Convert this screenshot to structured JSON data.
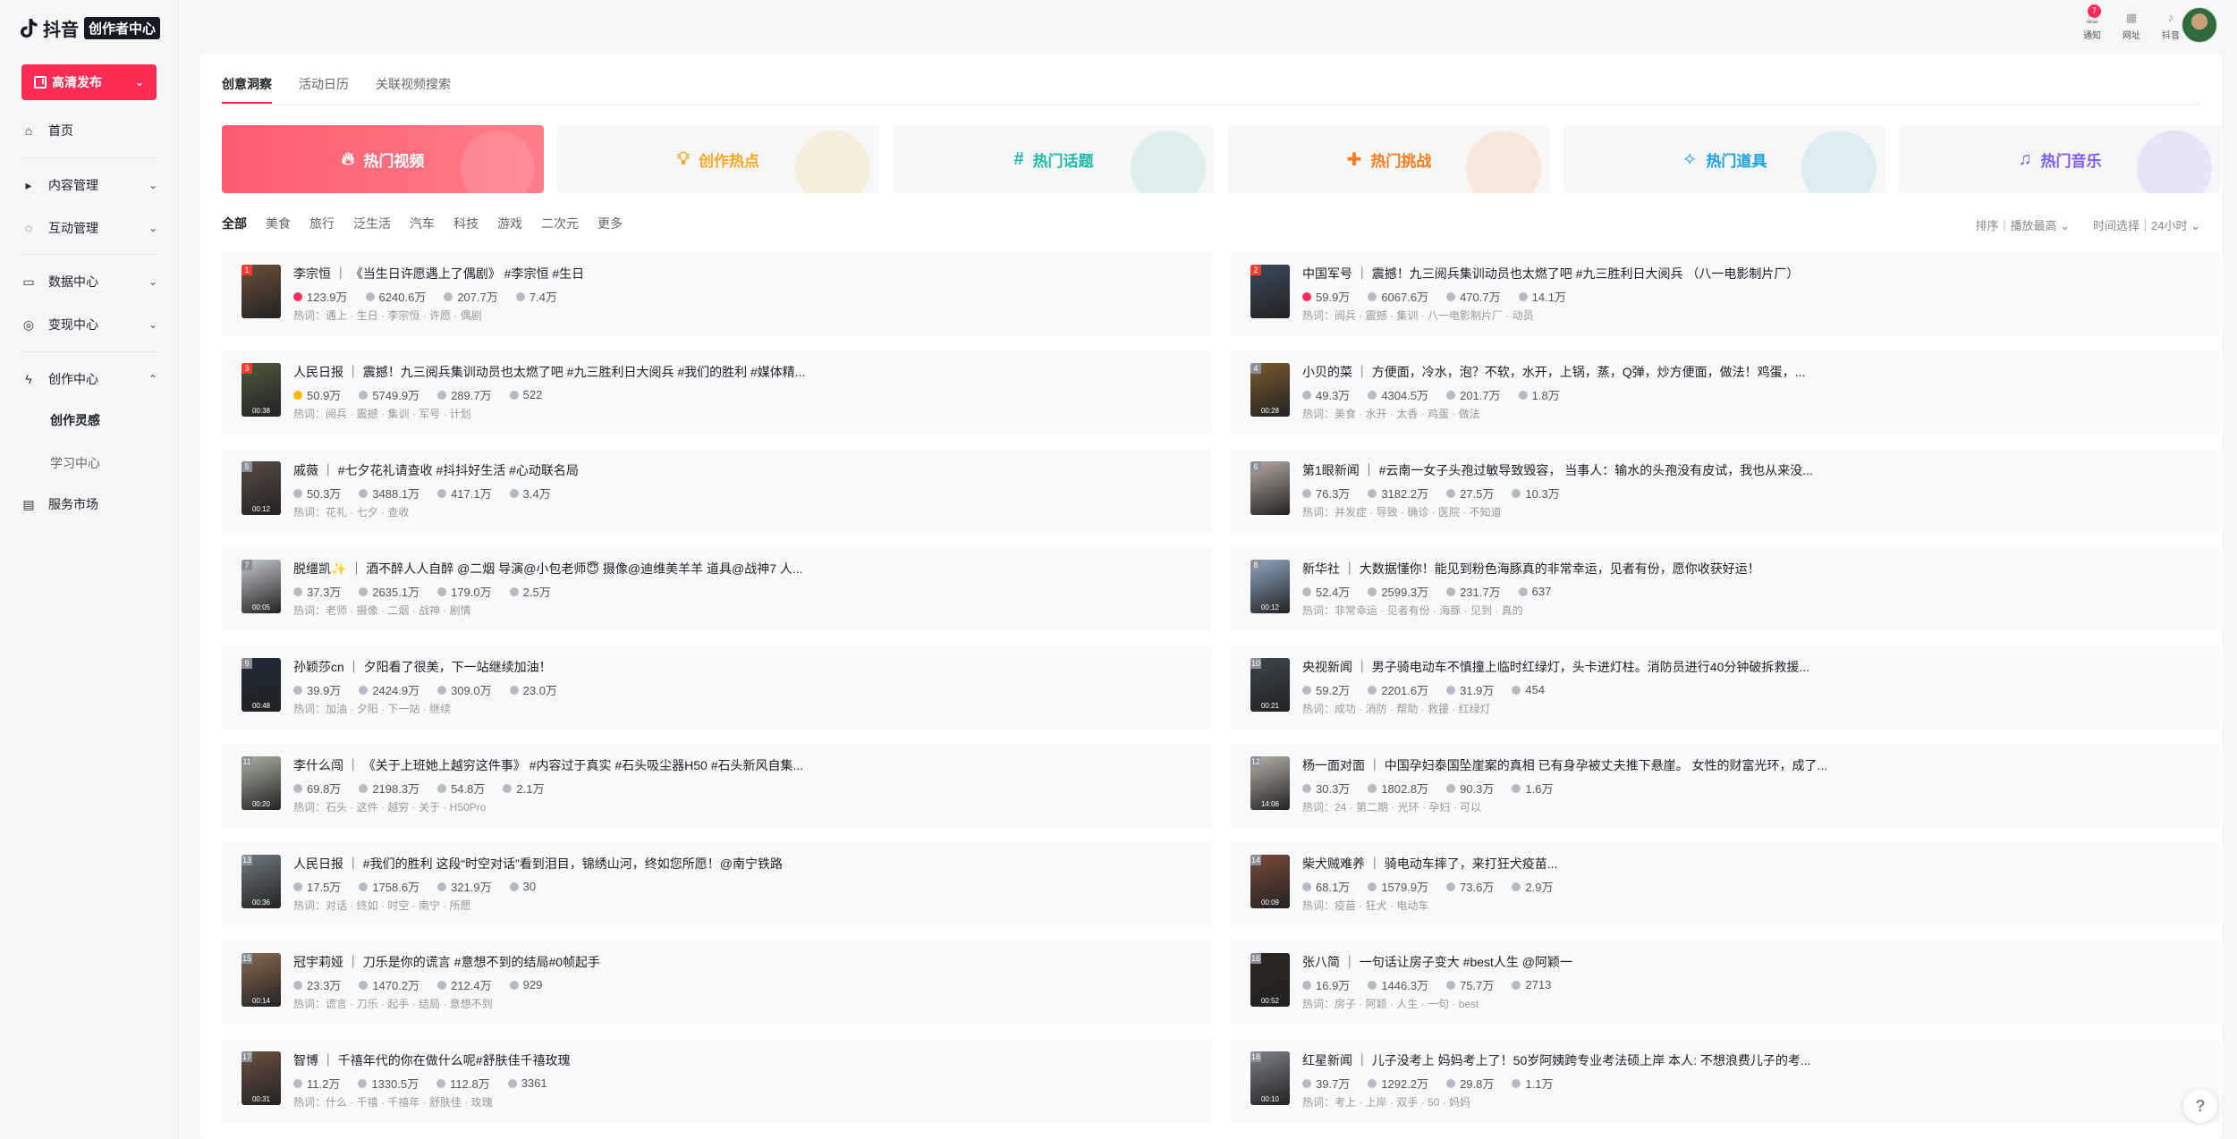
{
  "app": {
    "logo_text": "抖音",
    "badge": "创作者中心"
  },
  "sidebar": {
    "publish_label": "高清发布",
    "items": [
      {
        "label": "首页",
        "icon": "home-icon",
        "glyph": "⌂",
        "chevron": ""
      },
      {
        "label": "内容管理",
        "icon": "content-icon",
        "glyph": "▸",
        "chevron": "⌄"
      },
      {
        "label": "互动管理",
        "icon": "interaction-icon",
        "glyph": "◌",
        "chevron": "⌄"
      },
      {
        "label": "数据中心",
        "icon": "chart-icon",
        "glyph": "▭",
        "chevron": "⌄"
      },
      {
        "label": "变现中心",
        "icon": "monetize-icon",
        "glyph": "◎",
        "chevron": "⌄"
      },
      {
        "label": "创作中心",
        "icon": "bolt-icon",
        "glyph": "ϟ",
        "chevron": "⌃"
      },
      {
        "label": "服务市场",
        "icon": "market-icon",
        "glyph": "▤",
        "chevron": ""
      }
    ],
    "sub_items": [
      "创作灵感",
      "学习中心"
    ]
  },
  "header": {
    "icons": [
      {
        "label": "通知",
        "icon": "bell-icon",
        "glyph": "🔔︎",
        "badge": "7"
      },
      {
        "label": "网址",
        "icon": "grid-icon",
        "glyph": "▦",
        "badge": ""
      },
      {
        "label": "抖音",
        "icon": "tiktok-icon",
        "glyph": "♪",
        "badge": ""
      }
    ]
  },
  "tabs": [
    "创意洞察",
    "活动日历",
    "关联视频搜索"
  ],
  "categories": [
    {
      "label": "热门视频",
      "glyph": "🔥︎",
      "color": "#ffffff",
      "active": true
    },
    {
      "label": "创作热点",
      "glyph": "💡︎",
      "color": "#f5a623",
      "active": false
    },
    {
      "label": "热门话题",
      "glyph": "#",
      "color": "#22b8a8",
      "active": false
    },
    {
      "label": "热门挑战",
      "glyph": "✚",
      "color": "#ff7a1a",
      "active": false
    },
    {
      "label": "热门道具",
      "glyph": "✧",
      "color": "#1aa1e0",
      "active": false
    },
    {
      "label": "热门音乐",
      "glyph": "♫",
      "color": "#7a5cf0",
      "active": false
    }
  ],
  "filters": [
    "全部",
    "美食",
    "旅行",
    "泛生活",
    "汽车",
    "科技",
    "游戏",
    "二次元",
    "更多"
  ],
  "sort_label": "排序｜播放最高",
  "time_label": "时间选择｜24小时",
  "items": [
    {
      "rank": "1",
      "dur": "",
      "thumb": "#6b4f3a",
      "title": "李宗恒 ｜ 《当生日许愿遇上了偶剧》 #李宗恒 #生日",
      "heat_type": "hot",
      "heat": "123.9万",
      "plays": "6240.6万",
      "likes": "207.7万",
      "shares": "7.4万",
      "keywords": "热词：遇上 · 生日 · 李宗恒 · 许愿 · 偶剧"
    },
    {
      "rank": "2",
      "dur": "",
      "thumb": "#3a4a5c",
      "title": "中国军号 ｜ 震撼！九三阅兵集训动员也太燃了吧 #九三胜利日大阅兵 （八一电影制片厂）",
      "heat_type": "hot",
      "heat": "59.9万",
      "plays": "6067.6万",
      "likes": "470.7万",
      "shares": "14.1万",
      "keywords": "热词：阅兵 · 震撼 · 集训 · 八一电影制片厂 · 动员"
    },
    {
      "rank": "3",
      "dur": "00:38",
      "thumb": "#4d5a3e",
      "title": "人民日报 ｜ 震撼！九三阅兵集训动员也太燃了吧 #九三胜利日大阅兵 #我们的胜利 #媒体精...",
      "heat_type": "star",
      "heat": "50.9万",
      "plays": "5749.9万",
      "likes": "289.7万",
      "shares": "522",
      "keywords": "热词：阅兵 · 震撼 · 集训 · 军号 · 计划"
    },
    {
      "rank": "4",
      "dur": "00:28",
      "thumb": "#7a5a2e",
      "title": "小贝的菜 ｜ 方便面，冷水，泡？不软，水开，上锅，蒸，Q弹，炒方便面，做法！鸡蛋，...",
      "heat_type": "pl",
      "heat": "49.3万",
      "plays": "4304.5万",
      "likes": "201.7万",
      "shares": "1.8万",
      "keywords": "热词：美食 · 水开 · 太香 · 鸡蛋 · 做法"
    },
    {
      "rank": "5",
      "dur": "00:12",
      "thumb": "#5a4a44",
      "title": "戚薇 ｜ #七夕花礼请查收 #抖抖好生活 #心动联名局",
      "heat_type": "pl",
      "heat": "50.3万",
      "plays": "3488.1万",
      "likes": "417.1万",
      "shares": "3.4万",
      "keywords": "热词：花礼 · 七夕 · 查收"
    },
    {
      "rank": "6",
      "dur": "",
      "thumb": "#b8a9a0",
      "title": "第1眼新闻 ｜ #云南一女子头孢过敏导致毁容， 当事人：输水的头孢没有皮试，我也从来没...",
      "heat_type": "pl",
      "heat": "76.3万",
      "plays": "3182.2万",
      "likes": "27.5万",
      "shares": "10.3万",
      "keywords": "热词：并发症 · 导致 · 确诊 · 医院 · 不知道"
    },
    {
      "rank": "7",
      "dur": "00:05",
      "thumb": "#c4c7cc",
      "title": "脱缰凯✨ ｜ 酒不醉人人自醉 @二烟 导演@小包老师😇 摄像@迪维美羊羊 道具@战神7 人...",
      "heat_type": "pl",
      "heat": "37.3万",
      "plays": "2635.1万",
      "likes": "179.0万",
      "shares": "2.5万",
      "keywords": "热词：老师 · 摄像 · 二烟 · 战神 · 剧情"
    },
    {
      "rank": "8",
      "dur": "00:12",
      "thumb": "#8fa7c4",
      "title": "新华社 ｜ 大数据懂你！能见到粉色海豚真的非常幸运，见者有份，愿你收获好运！",
      "heat_type": "pl",
      "heat": "52.4万",
      "plays": "2599.3万",
      "likes": "231.7万",
      "shares": "637",
      "keywords": "热词：非常幸运 · 见者有份 · 海豚 · 见到 · 真的"
    },
    {
      "rank": "9",
      "dur": "00:48",
      "thumb": "#1f2a3a",
      "title": "孙颖莎cn ｜ 夕阳看了很美，下一站继续加油！",
      "heat_type": "pl",
      "heat": "39.9万",
      "plays": "2424.9万",
      "likes": "309.0万",
      "shares": "23.0万",
      "keywords": "热词：加油 · 夕阳 · 下一站 · 继续"
    },
    {
      "rank": "10",
      "dur": "00:21",
      "thumb": "#3c4650",
      "title": "央视新闻 ｜ 男子骑电动车不慎撞上临时红绿灯，头卡进灯柱。消防员进行40分钟破拆救援...",
      "heat_type": "pl",
      "heat": "59.2万",
      "plays": "2201.6万",
      "likes": "31.9万",
      "shares": "454",
      "keywords": "热词：成功 · 消防 · 帮助 · 救援 · 红绿灯"
    },
    {
      "rank": "11",
      "dur": "00:20",
      "thumb": "#a9b2a0",
      "title": "李什么闯 ｜ 《关于上班她上越穷这件事》 #内容过于真实 #石头吸尘器H50 #石头新风自集...",
      "heat_type": "pl",
      "heat": "69.8万",
      "plays": "2198.3万",
      "likes": "54.8万",
      "shares": "2.1万",
      "keywords": "热词：石头 · 这件 · 越穷 · 关于 · H50Pro"
    },
    {
      "rank": "12",
      "dur": "14:06",
      "thumb": "#b8b0a8",
      "title": "杨一面对面 ｜ 中国孕妇泰国坠崖案的真相 已有身孕被丈夫推下悬崖。 女性的财富光环，成了...",
      "heat_type": "pl",
      "heat": "30.3万",
      "plays": "1802.8万",
      "likes": "90.3万",
      "shares": "1.6万",
      "keywords": "热词：24 · 第二期 · 光环 · 孕妇 · 可以"
    },
    {
      "rank": "13",
      "dur": "00:36",
      "thumb": "#6f7a80",
      "title": "人民日报 ｜ #我们的胜利 这段“时空对话”看到泪目，锦绣山河，终如您所愿！@南宁铁路",
      "heat_type": "pl",
      "heat": "17.5万",
      "plays": "1758.6万",
      "likes": "321.9万",
      "shares": "30",
      "keywords": "热词：对话 · 终如 · 时空 · 南宁 · 所愿"
    },
    {
      "rank": "14",
      "dur": "00:09",
      "thumb": "#7a4a3a",
      "title": "柴犬贼难养 ｜ 骑电动车摔了，来打狂犬疫苗...",
      "heat_type": "pl",
      "heat": "68.1万",
      "plays": "1579.9万",
      "likes": "73.6万",
      "shares": "2.9万",
      "keywords": "热词：疫苗 · 狂犬 · 电动车"
    },
    {
      "rank": "15",
      "dur": "00:14",
      "thumb": "#8a6a50",
      "title": "冠宇莉娅 ｜ 刀乐是你的谎言 #意想不到的结局#0帧起手",
      "heat_type": "pl",
      "heat": "23.3万",
      "plays": "1470.2万",
      "likes": "212.4万",
      "shares": "929",
      "keywords": "热词：谎言 · 刀乐 · 起手 · 结局 · 意想不到"
    },
    {
      "rank": "16",
      "dur": "00:52",
      "thumb": "#2e2622",
      "title": "张八简 ｜ 一句话让房子变大 #best人生 @阿颖一",
      "heat_type": "pl",
      "heat": "16.9万",
      "plays": "1446.3万",
      "likes": "75.7万",
      "shares": "2713",
      "keywords": "热词：房子 · 阿颖 · 人生 · 一句 · best"
    },
    {
      "rank": "17",
      "dur": "00:31",
      "thumb": "#6a5040",
      "title": "智博 ｜ 千禧年代的你在做什么呢#舒肤佳千禧玫瑰",
      "heat_type": "pl",
      "heat": "11.2万",
      "plays": "1330.5万",
      "likes": "112.8万",
      "shares": "3361",
      "keywords": "热词：什么 · 千禧 · 千禧年 · 舒肤佳 · 玫瑰"
    },
    {
      "rank": "18",
      "dur": "00:10",
      "thumb": "#7c8088",
      "title": "红星新闻 ｜ 儿子没考上 妈妈考上了！50岁阿姨跨专业考法硕上岸 本人: 不想浪费儿子的考...",
      "heat_type": "pl",
      "heat": "39.7万",
      "plays": "1292.2万",
      "likes": "29.8万",
      "shares": "1.1万",
      "keywords": "热词：考上 · 上岸 · 双手 · 50 · 妈妈"
    }
  ],
  "help_glyph": "?"
}
